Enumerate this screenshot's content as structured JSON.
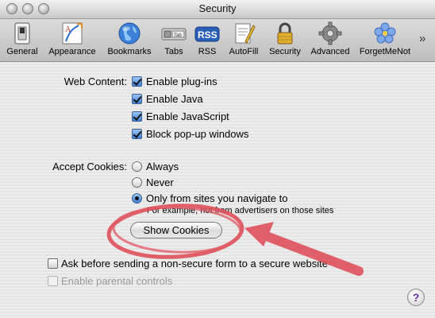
{
  "window": {
    "title": "Security"
  },
  "toolbar": {
    "items": [
      {
        "label": "General",
        "icon": "switch-icon"
      },
      {
        "label": "Appearance",
        "icon": "appearance-icon"
      },
      {
        "label": "Bookmarks",
        "icon": "globe-icon"
      },
      {
        "label": "Tabs",
        "icon": "tabs-icon"
      },
      {
        "label": "RSS",
        "icon": "rss-icon"
      },
      {
        "label": "AutoFill",
        "icon": "autofill-icon"
      },
      {
        "label": "Security",
        "icon": "lock-icon"
      },
      {
        "label": "Advanced",
        "icon": "gear-icon"
      },
      {
        "label": "ForgetMeNot",
        "icon": "flower-icon"
      }
    ],
    "more": "»"
  },
  "web_content": {
    "label": "Web Content:",
    "options": [
      {
        "label": "Enable plug-ins",
        "checked": true
      },
      {
        "label": "Enable Java",
        "checked": true
      },
      {
        "label": "Enable JavaScript",
        "checked": true
      },
      {
        "label": "Block pop-up windows",
        "checked": true
      }
    ]
  },
  "cookies": {
    "label": "Accept Cookies:",
    "options": [
      {
        "label": "Always",
        "selected": false
      },
      {
        "label": "Never",
        "selected": false
      },
      {
        "label": "Only from sites you navigate to",
        "selected": true
      }
    ],
    "note": "For example, not from advertisers on those sites",
    "button": "Show Cookies"
  },
  "form_warning": {
    "label": "Ask before sending a non-secure form to a secure website",
    "checked": false
  },
  "parental": {
    "label": "Enable parental controls",
    "checked": false,
    "enabled": false
  },
  "help": {
    "label": "?"
  },
  "colors": {
    "annotation": "#e0505a",
    "checkbox_fill": "#3f7fd6",
    "rss_badge": "#2a5fb8"
  }
}
